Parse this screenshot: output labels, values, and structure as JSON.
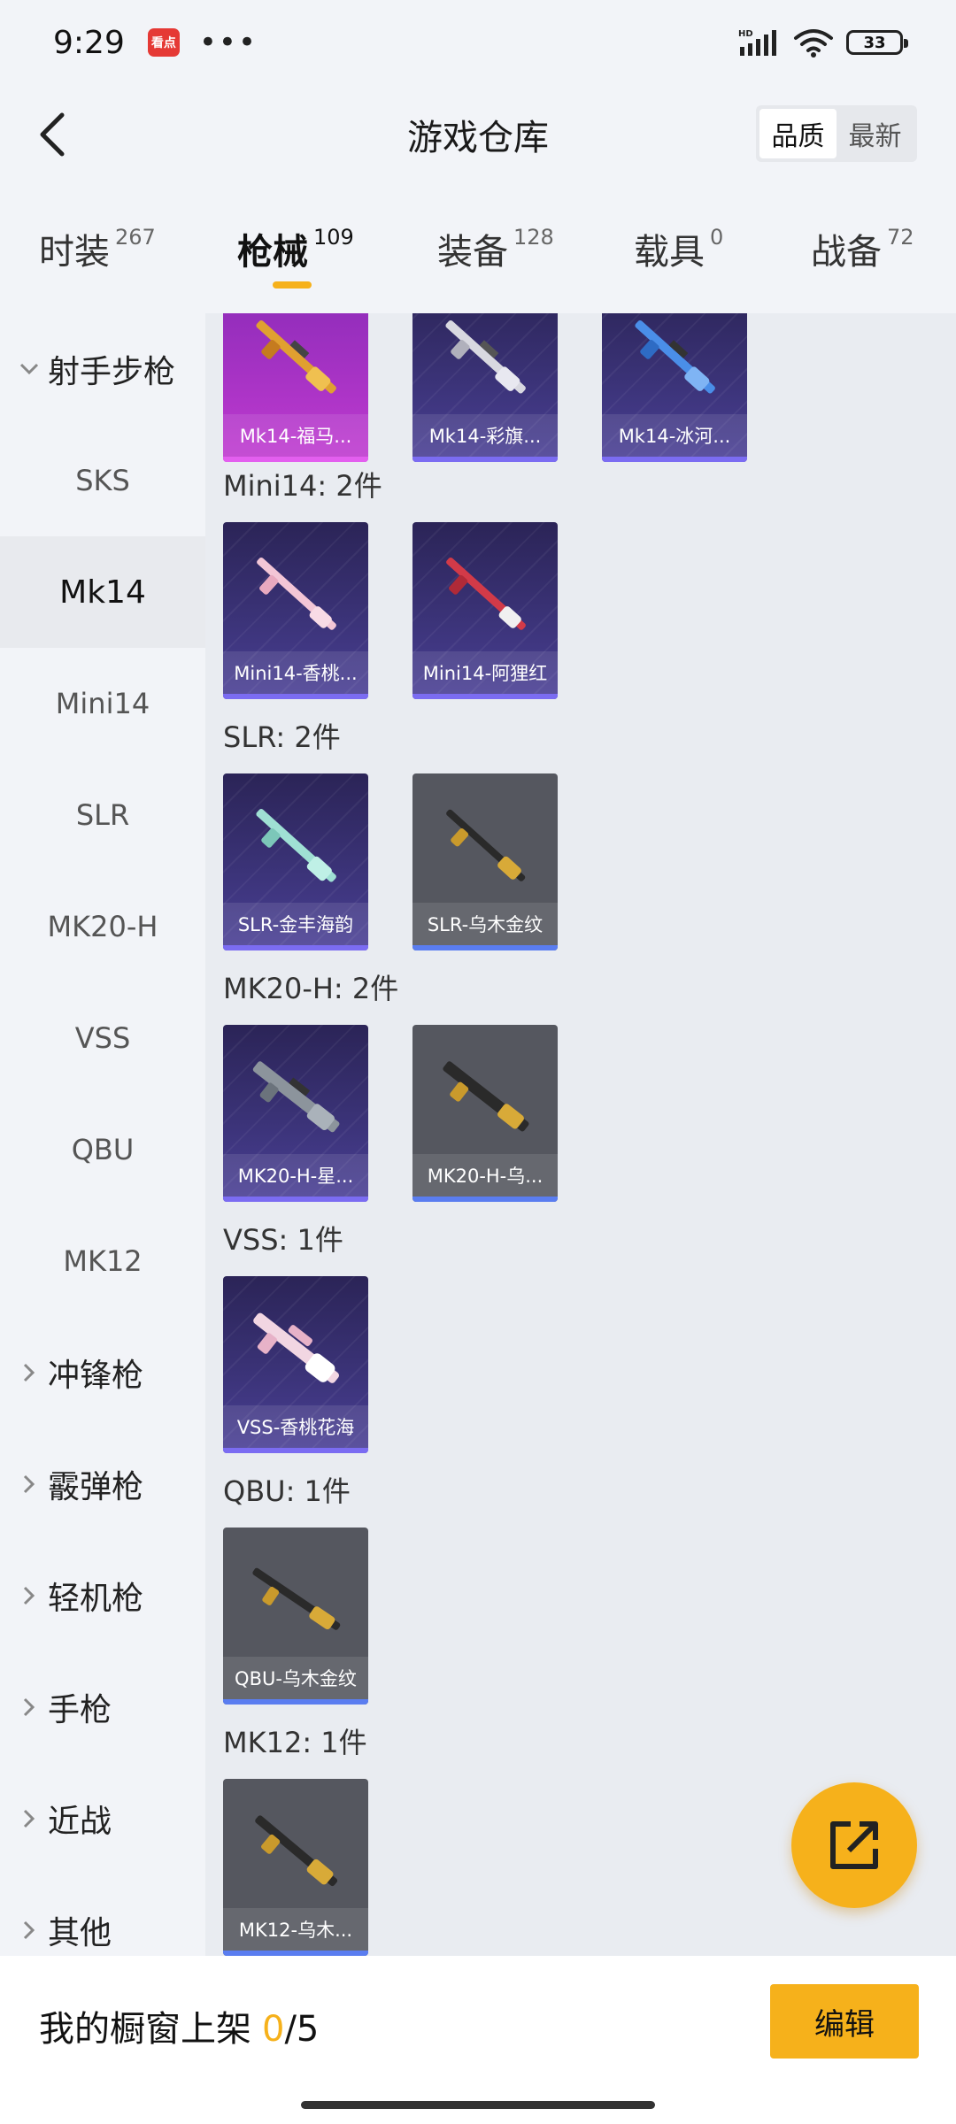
{
  "status_bar": {
    "time": "9:29",
    "app_badge": "看点",
    "more": "•••",
    "network_label": "HD",
    "battery": "33"
  },
  "header": {
    "title": "游戏仓库",
    "sort_options": [
      "品质",
      "最新"
    ],
    "active_sort": "品质"
  },
  "tabs": [
    {
      "label": "时装",
      "count": "267"
    },
    {
      "label": "枪械",
      "count": "109"
    },
    {
      "label": "装备",
      "count": "128"
    },
    {
      "label": "载具",
      "count": "0"
    },
    {
      "label": "战备",
      "count": "72"
    }
  ],
  "active_tab": "枪械",
  "side_nav": {
    "expanded_group": "射手步枪",
    "sub_items": [
      "SKS",
      "Mk14",
      "Mini14",
      "SLR",
      "MK20-H",
      "VSS",
      "QBU",
      "MK12"
    ],
    "active_item": "Mk14",
    "collapsed_groups": [
      "冲锋枪",
      "霰弹枪",
      "轻机枪",
      "手枪",
      "近战",
      "其他"
    ]
  },
  "sections": [
    {
      "title": "",
      "items": [
        {
          "label": "Mk14-福马...",
          "rarity": "magenta",
          "icon": "rifle-golden-icon"
        },
        {
          "label": "Mk14-彩旗...",
          "rarity": "purple",
          "icon": "rifle-silver-icon"
        },
        {
          "label": "Mk14-冰河...",
          "rarity": "purple",
          "icon": "rifle-blue-icon"
        }
      ]
    },
    {
      "title": "Mini14: 2件",
      "items": [
        {
          "label": "Mini14-香桃...",
          "rarity": "purple",
          "icon": "rifle-pink-icon"
        },
        {
          "label": "Mini14-阿狸红",
          "rarity": "purple",
          "icon": "rifle-red-icon"
        }
      ]
    },
    {
      "title": "SLR: 2件",
      "items": [
        {
          "label": "SLR-金丰海韵",
          "rarity": "purple",
          "icon": "rifle-mint-icon"
        },
        {
          "label": "SLR-乌木金纹",
          "rarity": "grey",
          "icon": "rifle-gold-black-icon"
        }
      ]
    },
    {
      "title": "MK20-H: 2件",
      "items": [
        {
          "label": "MK20-H-星...",
          "rarity": "purple",
          "icon": "rifle-steel-icon"
        },
        {
          "label": "MK20-H-乌...",
          "rarity": "grey",
          "icon": "rifle-gold-black-icon"
        }
      ]
    },
    {
      "title": "VSS: 1件",
      "items": [
        {
          "label": "VSS-香桃花海",
          "rarity": "purple",
          "icon": "rifle-pink-white-icon"
        }
      ]
    },
    {
      "title": "QBU: 1件",
      "items": [
        {
          "label": "QBU-乌木金纹",
          "rarity": "grey",
          "icon": "rifle-gold-black-icon"
        }
      ]
    },
    {
      "title": "MK12: 1件",
      "items": [
        {
          "label": "MK12-乌木...",
          "rarity": "grey",
          "icon": "rifle-gold-black-icon"
        }
      ]
    }
  ],
  "bottom_bar": {
    "showcase_label": "我的橱窗上架",
    "showcase_count": "0",
    "showcase_total": "/5",
    "edit_label": "编辑"
  },
  "colors": {
    "accent": "#f6b11b",
    "purple_card": "#3b3378",
    "grey_card": "#55575f",
    "magenta_card": "#c03ad0"
  }
}
